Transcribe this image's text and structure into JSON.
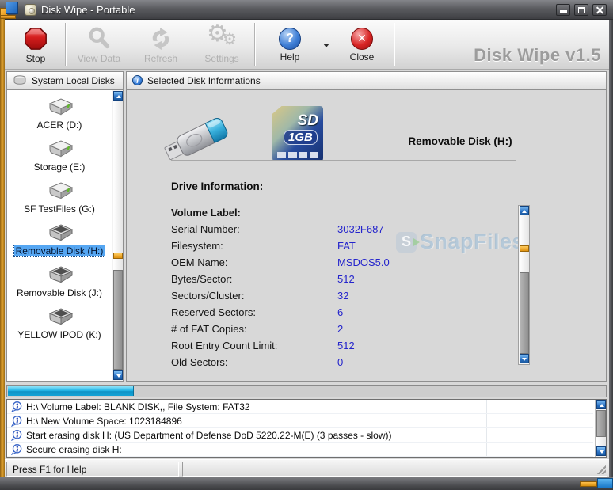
{
  "window": {
    "title": "Disk Wipe  - Portable",
    "controls": [
      {
        "name": "minimize"
      },
      {
        "name": "maximize"
      },
      {
        "name": "close"
      }
    ]
  },
  "toolbar": {
    "buttons": [
      {
        "label": "Stop",
        "enabled": true
      },
      {
        "label": "View Data",
        "enabled": false
      },
      {
        "label": "Refresh",
        "enabled": false
      },
      {
        "label": "Settings",
        "enabled": false
      },
      {
        "label": "Help",
        "enabled": true
      },
      {
        "label": "Close",
        "enabled": true
      }
    ],
    "brand": "Disk Wipe v1.5"
  },
  "panels": {
    "left": {
      "header": "System Local Disks",
      "drives": [
        {
          "label": "ACER (D:)",
          "type": "fixed",
          "selected": false
        },
        {
          "label": "Storage (E:)",
          "type": "fixed",
          "selected": false
        },
        {
          "label": "SF TestFiles (G:)",
          "type": "fixed",
          "selected": false
        },
        {
          "label": "Removable Disk (H:)",
          "type": "removable",
          "selected": true
        },
        {
          "label": "Removable Disk (J:)",
          "type": "removable",
          "selected": false
        },
        {
          "label": "YELLOW IPOD (K:)",
          "type": "removable",
          "selected": false
        }
      ]
    },
    "right": {
      "header": "Selected Disk Informations",
      "disk_title": "Removable Disk  (H:)",
      "sd_icon": {
        "label": "SD",
        "capacity": "1GB"
      },
      "section_title": "Drive Information:",
      "fields": [
        {
          "label": "Volume Label:",
          "value": ""
        },
        {
          "label": "Serial Number:",
          "value": "3032F687"
        },
        {
          "label": "Filesystem:",
          "value": "FAT"
        },
        {
          "label": "OEM Name:",
          "value": "MSDOS5.0"
        },
        {
          "label": "Bytes/Sector:",
          "value": "512"
        },
        {
          "label": "Sectors/Cluster:",
          "value": "32"
        },
        {
          "label": "Reserved Sectors:",
          "value": "6"
        },
        {
          "label": "# of FAT Copies:",
          "value": "2"
        },
        {
          "label": "Root Entry Count Limit:",
          "value": "512"
        },
        {
          "label": "Old Sectors:",
          "value": "0"
        }
      ],
      "watermark": {
        "logo": "S",
        "text": "SnapFiles"
      }
    }
  },
  "progress": {
    "percent": 21
  },
  "log": {
    "entries": [
      "H:\\ Volume Label: BLANK DISK,, File System: FAT32",
      "H:\\ New Volume Space: 1023184896",
      "Start erasing disk H: (US Department of Defense DoD 5220.22-M(E) (3 passes - slow))",
      "Secure erasing disk H:"
    ]
  },
  "status_bar": {
    "text": "Press F1 for Help"
  },
  "colors": {
    "value_blue": "#2424cc",
    "selection_blue": "#55a6f2",
    "progress_cyan": "#25b6e6",
    "frame_orange": "#e8a832",
    "stop_red": "#d41d1d",
    "help_blue": "#3f7fd6"
  }
}
